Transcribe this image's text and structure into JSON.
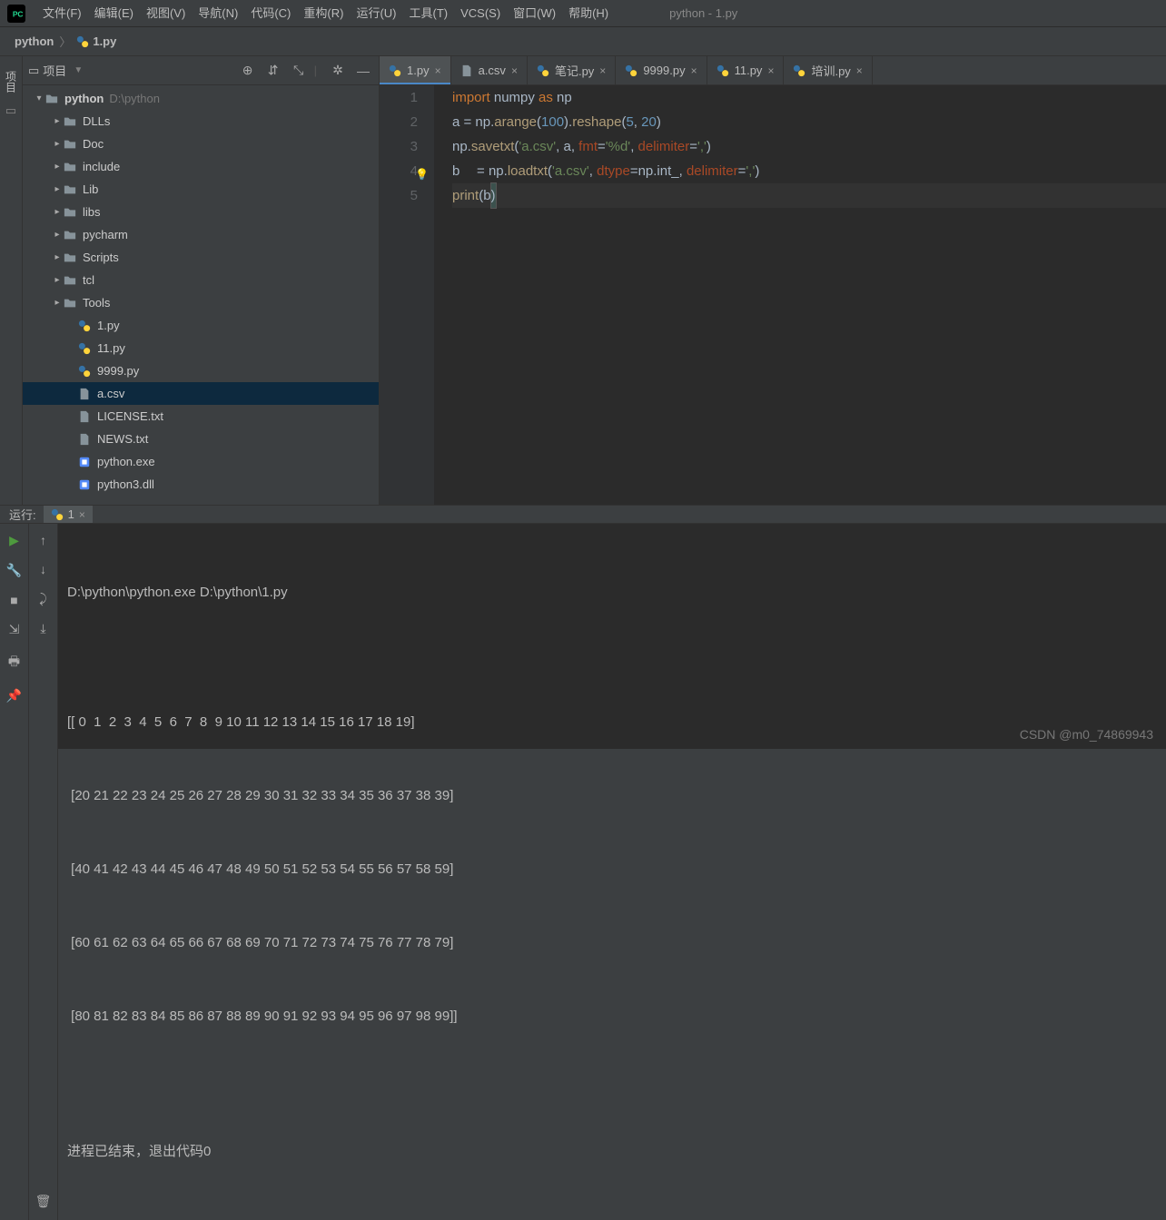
{
  "window_title": "python - 1.py",
  "menubar": [
    "文件(F)",
    "编辑(E)",
    "视图(V)",
    "导航(N)",
    "代码(C)",
    "重构(R)",
    "运行(U)",
    "工具(T)",
    "VCS(S)",
    "窗口(W)",
    "帮助(H)"
  ],
  "breadcrumb": {
    "root": "python",
    "file": "1.py"
  },
  "left_gutter_label": "项目",
  "project_panel": {
    "title": "项目",
    "root": {
      "name": "python",
      "path": "D:\\python"
    },
    "folders": [
      "DLLs",
      "Doc",
      "include",
      "Lib",
      "libs",
      "pycharm",
      "Scripts",
      "tcl",
      "Tools"
    ],
    "files": [
      {
        "name": "1.py",
        "type": "py"
      },
      {
        "name": "11.py",
        "type": "py"
      },
      {
        "name": "9999.py",
        "type": "py"
      },
      {
        "name": "a.csv",
        "type": "file",
        "selected": true
      },
      {
        "name": "LICENSE.txt",
        "type": "file"
      },
      {
        "name": "NEWS.txt",
        "type": "file"
      },
      {
        "name": "python.exe",
        "type": "exe"
      },
      {
        "name": "python3.dll",
        "type": "exe"
      }
    ]
  },
  "tabs": [
    {
      "name": "1.py",
      "type": "py",
      "active": true
    },
    {
      "name": "a.csv",
      "type": "file"
    },
    {
      "name": "笔记.py",
      "type": "py"
    },
    {
      "name": "9999.py",
      "type": "py"
    },
    {
      "name": "11.py",
      "type": "py"
    },
    {
      "name": "培训.py",
      "type": "py"
    }
  ],
  "code": {
    "line1": {
      "t": [
        "import",
        " numpy ",
        "as",
        " np"
      ]
    },
    "line2": {
      "t": [
        "a = np.",
        "arange",
        "(",
        "100",
        ").",
        "reshape",
        "(",
        "5",
        ", ",
        "20",
        ")"
      ]
    },
    "line3": {
      "t": [
        "np.",
        "savetxt",
        "(",
        "'a.csv'",
        ", a, ",
        "fmt",
        "=",
        "'%d'",
        ", ",
        "delimiter",
        "=",
        "','",
        ")"
      ]
    },
    "line4": {
      "t": [
        "b",
        "= np.",
        "loadtxt",
        "(",
        "'a.csv'",
        ", ",
        "dtype",
        "=np.int_, ",
        "delimiter",
        "=",
        "','",
        ")"
      ]
    },
    "line5": {
      "t": [
        "print",
        "(",
        "b",
        ")"
      ]
    }
  },
  "line_numbers": [
    "1",
    "2",
    "3",
    "4",
    "5"
  ],
  "run": {
    "title": "运行:",
    "tab": "1",
    "command": "D:\\python\\python.exe D:\\python\\1.py",
    "output": [
      "[[ 0  1  2  3  4  5  6  7  8  9 10 11 12 13 14 15 16 17 18 19]",
      " [20 21 22 23 24 25 26 27 28 29 30 31 32 33 34 35 36 37 38 39]",
      " [40 41 42 43 44 45 46 47 48 49 50 51 52 53 54 55 56 57 58 59]",
      " [60 61 62 63 64 65 66 67 68 69 70 71 72 73 74 75 76 77 78 79]",
      " [80 81 82 83 84 85 86 87 88 89 90 91 92 93 94 95 96 97 98 99]]"
    ],
    "exit": "进程已结束，退出代码0"
  },
  "watermark": "CSDN @m0_74869943"
}
